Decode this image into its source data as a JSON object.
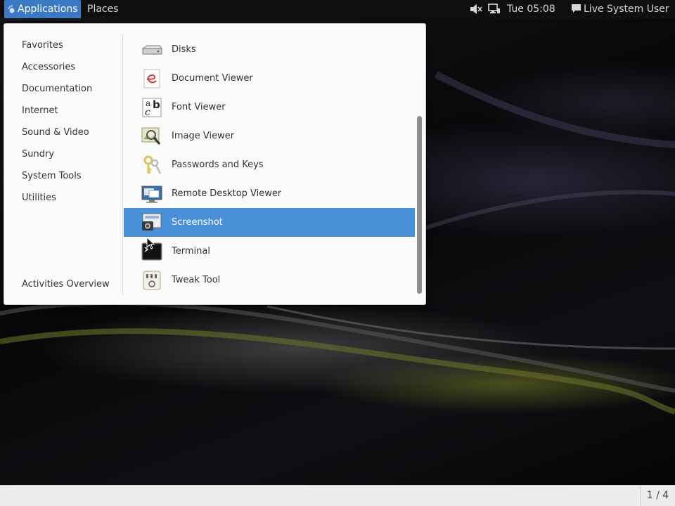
{
  "topbar": {
    "applications_label": "Applications",
    "places_label": "Places",
    "clock": "Tue 05:08",
    "user_name": "Live System User",
    "icons": [
      "gnome-foot-icon",
      "volume-muted-icon",
      "network-wired-icon",
      "chat-bubble-icon"
    ]
  },
  "menu": {
    "categories": [
      {
        "label": "Favorites"
      },
      {
        "label": "Accessories"
      },
      {
        "label": "Documentation"
      },
      {
        "label": "Internet"
      },
      {
        "label": "Sound & Video"
      },
      {
        "label": "Sundry"
      },
      {
        "label": "System Tools"
      },
      {
        "label": "Utilities"
      }
    ],
    "activities_overview": "Activities Overview",
    "apps": [
      {
        "label": "Disks",
        "icon": "disks-icon"
      },
      {
        "label": "Document Viewer",
        "icon": "document-viewer-icon"
      },
      {
        "label": "Font Viewer",
        "icon": "font-viewer-icon"
      },
      {
        "label": "Image Viewer",
        "icon": "image-viewer-icon"
      },
      {
        "label": "Passwords and Keys",
        "icon": "passwords-keys-icon"
      },
      {
        "label": "Remote Desktop Viewer",
        "icon": "remote-desktop-icon"
      },
      {
        "label": "Screenshot",
        "icon": "screenshot-icon",
        "selected": true
      },
      {
        "label": "Terminal",
        "icon": "terminal-icon"
      },
      {
        "label": "Tweak Tool",
        "icon": "tweak-tool-icon"
      }
    ],
    "font_viewer_glyphs": [
      "a",
      "b",
      "c"
    ]
  },
  "bottombar": {
    "workspace_indicator": "1 / 4"
  },
  "colors": {
    "accent": "#3b79c5",
    "selection": "#4a90d9",
    "menu_background": "#fbfbfb",
    "topbar_background": "#0f0f0f",
    "bottombar_background": "#ececec"
  }
}
